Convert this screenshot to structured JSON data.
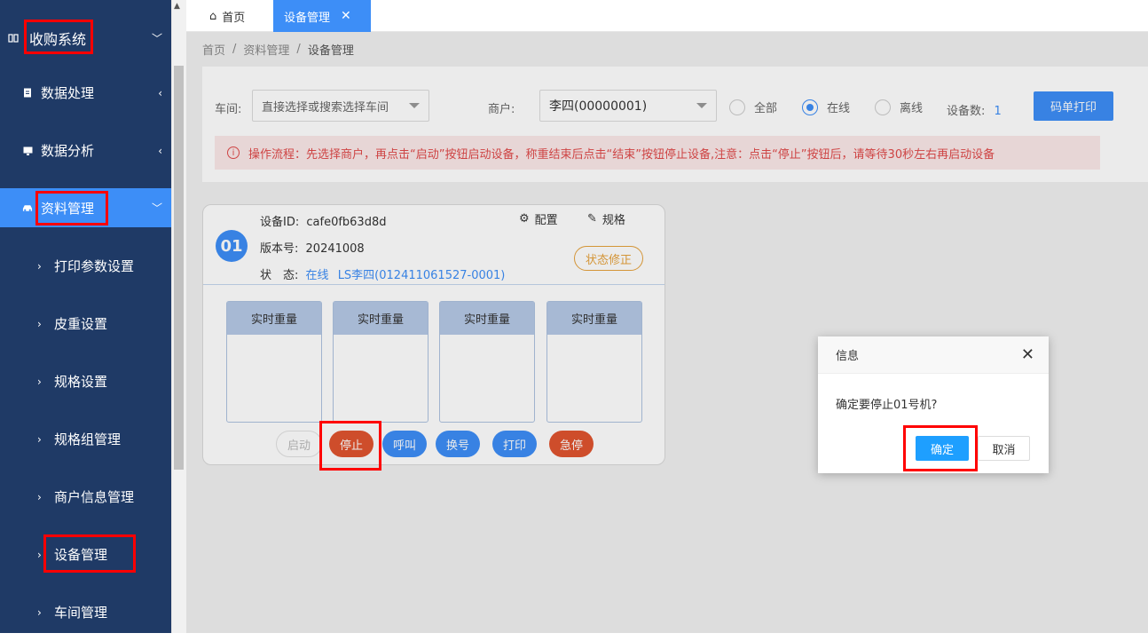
{
  "sidebar": {
    "system": "收购系统",
    "items": [
      {
        "label": "数据处理"
      },
      {
        "label": "数据分析"
      },
      {
        "label": "资料管理"
      }
    ],
    "subitems": [
      {
        "label": "打印参数设置"
      },
      {
        "label": "皮重设置"
      },
      {
        "label": "规格设置"
      },
      {
        "label": "规格组管理"
      },
      {
        "label": "商户信息管理"
      },
      {
        "label": "设备管理"
      },
      {
        "label": "车间管理"
      }
    ]
  },
  "tabs": {
    "home": "首页",
    "active": "设备管理",
    "close": "✕",
    "home_icon": "⌂"
  },
  "breadcrumb": {
    "a": "首页",
    "sep": "/",
    "b": "资料管理",
    "c": "设备管理"
  },
  "filter": {
    "workshop_label": "车间:",
    "workshop_placeholder": "直接选择或搜索选择车间",
    "merchant_label": "商户:",
    "merchant_value": "李四(00000001)",
    "radio_all": "全部",
    "radio_online": "在线",
    "radio_offline": "离线",
    "count_label": "设备数:",
    "count_value": "1",
    "print_btn": "码单打印"
  },
  "notice": "操作流程：先选择商户，再点击“启动”按钮启动设备，称重结束后点击“结束”按钮停止设备,注意：点击“停止”按钮后，请等待30秒左右再启动设备",
  "device": {
    "num": "01",
    "id_label": "设备ID:",
    "id_value": "cafe0fb63d8d",
    "ver_label": "版本号:",
    "ver_value": "20241008",
    "status_label": "状　态:",
    "status_value": "在线",
    "status_user": "LS李四(012411061527-0001)",
    "config": "配置",
    "spec": "规格",
    "fix": "状态修正",
    "weight_title": "实时重量",
    "buttons": {
      "start": "启动",
      "stop": "停止",
      "call": "呼叫",
      "swap": "换号",
      "print": "打印",
      "estop": "急停"
    }
  },
  "dialog": {
    "title": "信息",
    "message": "确定要停止01号机?",
    "ok": "确定",
    "cancel": "取消"
  },
  "colors": {
    "sidebar": "#1f3a66",
    "accent": "#3d8ef7",
    "danger": "#e0542f",
    "highlight": "#ff0000"
  }
}
